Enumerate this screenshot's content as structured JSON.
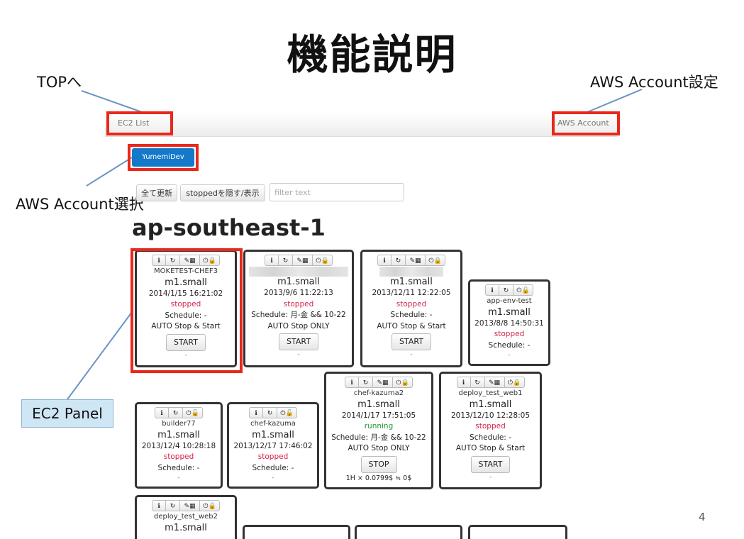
{
  "slide": {
    "title": "機能説明",
    "page_number": "4"
  },
  "callouts": {
    "top": "TOPへ",
    "account_setting": "AWS Account設定",
    "account_select": "AWS Account選択",
    "panel": "EC2 Panel"
  },
  "navbar": {
    "brand": "EC2 List",
    "account_link": "AWS Account"
  },
  "account_button": "YumemiDev",
  "toolbar": {
    "refresh": "全て更新",
    "toggle_stopped": "stoppedを隠す/表示",
    "filter_placeholder": "filter text"
  },
  "region": "ap-southeast-1",
  "panels": [
    {
      "name": "MOKETEST-CHEF3",
      "type": "m1.small",
      "date": "2014/1/15 16:21:02",
      "status": "stopped",
      "schedule": "Schedule: -",
      "auto": "AUTO Stop & Start",
      "action": "START",
      "footer": "-"
    },
    {
      "name": "",
      "type": "m1.small",
      "date": "2013/9/6 11:22:13",
      "status": "stopped",
      "schedule": "Schedule: 月-金 && 10-22",
      "auto": "AUTO Stop ONLY",
      "action": "START",
      "footer": "-"
    },
    {
      "name": "",
      "type": "m1.small",
      "date": "2013/12/11 12:22:05",
      "status": "stopped",
      "schedule": "Schedule: -",
      "auto": "AUTO Stop & Start",
      "action": "START",
      "footer": "-"
    },
    {
      "name": "app-env-test",
      "type": "m1.small",
      "date": "2013/8/8 14:50:31",
      "status": "stopped",
      "schedule": "Schedule: -",
      "footer": "-"
    },
    {
      "name": "chef-kazuma2",
      "type": "m1.small",
      "date": "2014/1/17 17:51:05",
      "status": "running",
      "schedule": "Schedule: 月-金 && 10-22",
      "auto": "AUTO Stop ONLY",
      "action": "STOP",
      "footer": "1H × 0.0799$ ≒ 0$"
    },
    {
      "name": "deploy_test_web1",
      "type": "m1.small",
      "date": "2013/12/10 12:28:05",
      "status": "stopped",
      "schedule": "Schedule: -",
      "auto": "AUTO Stop & Start",
      "action": "START",
      "footer": "-"
    },
    {
      "name": "builder77",
      "type": "m1.small",
      "date": "2013/12/4 10:28:18",
      "status": "stopped",
      "schedule": "Schedule: -",
      "footer": "-"
    },
    {
      "name": "chef-kazuma",
      "type": "m1.small",
      "date": "2013/12/17 17:46:02",
      "status": "stopped",
      "schedule": "Schedule: -",
      "footer": "-"
    },
    {
      "name": "deploy_test_web2",
      "type": "m1.small"
    }
  ],
  "colors": {
    "highlight": "#e8281b",
    "stopped": "#d0244a",
    "running": "#1f9a3a",
    "account_button": "#1479c8"
  }
}
